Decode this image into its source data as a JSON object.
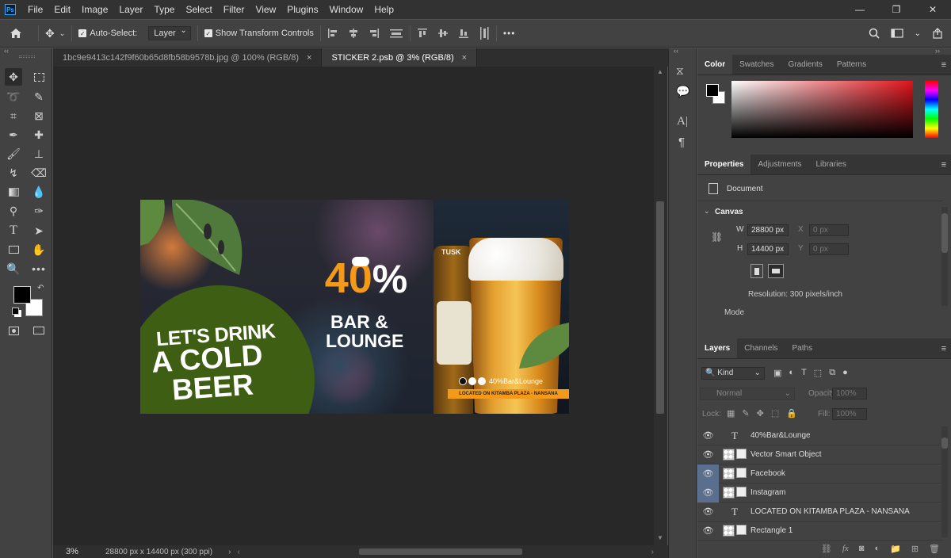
{
  "app": {
    "logo_text": "Ps"
  },
  "menu": [
    "File",
    "Edit",
    "Image",
    "Layer",
    "Type",
    "Select",
    "Filter",
    "View",
    "Plugins",
    "Window",
    "Help"
  ],
  "window_controls": {
    "minimize": "—",
    "restore": "❐",
    "close": "✕"
  },
  "options": {
    "auto_select_label": "Auto-Select:",
    "auto_select_value": "Layer",
    "show_transform_label": "Show Transform Controls",
    "more_label": "•••"
  },
  "tabs": [
    {
      "label": "1bc9e9413c142f9f60b65d8fb58b9578b.jpg @ 100% (RGB/8)",
      "close": "×"
    },
    {
      "label": "STICKER 2.psb @ 3% (RGB/8)",
      "close": "×"
    }
  ],
  "status": {
    "zoom": "3%",
    "doc_info": "28800 px x 14400 px (300 ppi)"
  },
  "artwork": {
    "headline_line1": "LET'S DRINK",
    "headline_line2": "A COLD",
    "headline_line3": "BEER",
    "promo_number": "40",
    "promo_percent": "%",
    "promo_line1": "BAR &",
    "promo_line2": "LOUNGE",
    "bottle_label": "TUSK",
    "social_handle": "40%Bar&Lounge",
    "location_text": "LOCATED ON KITAMBA PLAZA - NANSANA"
  },
  "color_panel": {
    "tabs": [
      "Color",
      "Swatches",
      "Gradients",
      "Patterns"
    ],
    "active": "Color"
  },
  "properties_panel": {
    "tabs": [
      "Properties",
      "Adjustments",
      "Libraries"
    ],
    "doc_label": "Document",
    "section": "Canvas",
    "w_label": "W",
    "w_value": "28800 px",
    "h_label": "H",
    "h_value": "14400 px",
    "x_label": "X",
    "x_value": "0 px",
    "y_label": "Y",
    "y_value": "0 px",
    "resolution": "Resolution: 300 pixels/inch",
    "mode_label": "Mode"
  },
  "layers_panel": {
    "tabs": [
      "Layers",
      "Channels",
      "Paths"
    ],
    "kind_label": "Kind",
    "blend_mode": "Normal",
    "opacity_label": "Opacity:",
    "opacity_value": "100%",
    "lock_label": "Lock:",
    "fill_label": "Fill:",
    "fill_value": "100%",
    "layers": [
      {
        "name": "40%Bar&Lounge",
        "type": "text",
        "selected": false
      },
      {
        "name": "Vector Smart Object",
        "type": "smart",
        "selected": false
      },
      {
        "name": "Facebook",
        "type": "smart",
        "selected": true
      },
      {
        "name": "Instagram",
        "type": "smart",
        "selected": true
      },
      {
        "name": "LOCATED ON KITAMBA PLAZA - NANSANA",
        "type": "text",
        "selected": false
      },
      {
        "name": "Rectangle 1",
        "type": "shape",
        "selected": false
      }
    ]
  }
}
